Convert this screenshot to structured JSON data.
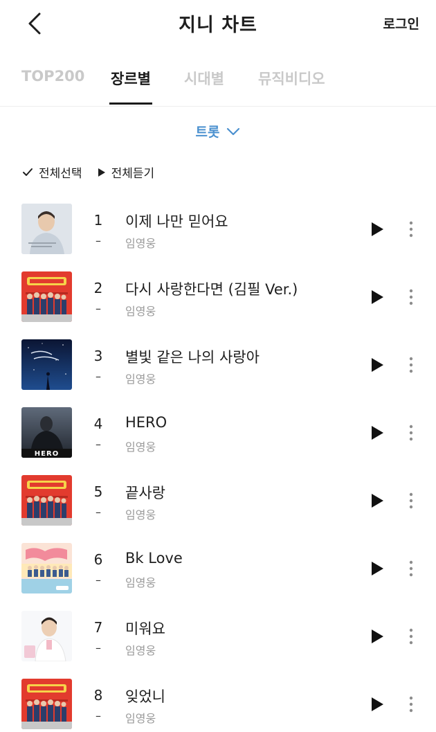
{
  "header": {
    "title": "지니 차트",
    "login_label": "로그인"
  },
  "tabs": [
    {
      "label": "TOP200",
      "active": false
    },
    {
      "label": "장르별",
      "active": true
    },
    {
      "label": "시대별",
      "active": false
    },
    {
      "label": "뮤직비디오",
      "active": false
    }
  ],
  "genre_selector": {
    "label": "트롯",
    "icon": "chevron-down-icon",
    "color": "#4a90cf"
  },
  "actions": {
    "select_all_label": "전체선택",
    "play_all_label": "전체듣기"
  },
  "songs": [
    {
      "rank": "1",
      "change": "–",
      "title": "이제 나만 믿어요",
      "artist": "임영웅"
    },
    {
      "rank": "2",
      "change": "–",
      "title": "다시 사랑한다면 (김필 Ver.)",
      "artist": "임영웅"
    },
    {
      "rank": "3",
      "change": "–",
      "title": "별빛 같은 나의 사랑아",
      "artist": "임영웅"
    },
    {
      "rank": "4",
      "change": "–",
      "title": "HERO",
      "artist": "임영웅"
    },
    {
      "rank": "5",
      "change": "–",
      "title": "끝사랑",
      "artist": "임영웅"
    },
    {
      "rank": "6",
      "change": "–",
      "title": "Bk Love",
      "artist": "임영웅"
    },
    {
      "rank": "7",
      "change": "–",
      "title": "미워요",
      "artist": "임영웅"
    },
    {
      "rank": "8",
      "change": "–",
      "title": "잊었니",
      "artist": "임영웅"
    }
  ],
  "album_art_text": {
    "hero": "HERO"
  }
}
